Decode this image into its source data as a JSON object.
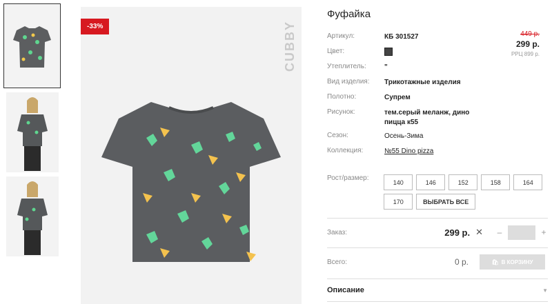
{
  "badge": "-33%",
  "brand": "CUBBY",
  "product": {
    "title": "Фуфайка",
    "attributes": [
      {
        "key": "Артикул:",
        "value": "КБ 301527"
      },
      {
        "key": "Цвет:",
        "value": ""
      },
      {
        "key": "Утеплитель:",
        "value": "\""
      },
      {
        "key": "Вид изделия:",
        "value": "Трикотажные изделия"
      },
      {
        "key": "Полотно:",
        "value": "Супрем"
      },
      {
        "key": "Рисунок:",
        "value": "тем.серый меланж, дино пицца к55"
      },
      {
        "key": "Сезон:",
        "value": "Осень-Зима"
      },
      {
        "key": "Коллекция:",
        "value": "№55 Dino pizza"
      }
    ],
    "color_hex": "#444444",
    "old_price": "449 р.",
    "new_price": "299 р.",
    "rrp": "РРЦ 899 р."
  },
  "sizes": {
    "label": "Рост/размер:",
    "items": [
      "140",
      "146",
      "152",
      "158",
      "164",
      "170"
    ],
    "select_all": "ВЫБРАТЬ ВСЕ"
  },
  "order": {
    "label": "Заказ:",
    "price": "299 р.",
    "times": "✕",
    "minus": "–",
    "plus": "+",
    "quantity": ""
  },
  "total": {
    "label": "Всего:",
    "value": "0 р.",
    "cart_button": "В КОРЗИНУ"
  },
  "description": {
    "label": "Описание"
  }
}
